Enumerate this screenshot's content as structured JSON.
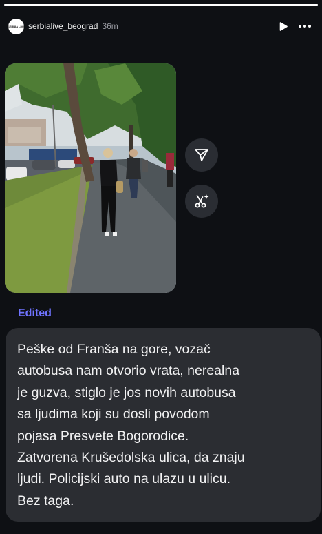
{
  "story": {
    "username": "serbialive_beograd",
    "timestamp": "36m",
    "avatar_text": "SERBIA LIVE",
    "progress": 1.0,
    "icons": {
      "play": "play-icon",
      "more": "more-icon",
      "share": "send-icon",
      "remix": "remix-icon"
    },
    "photo_icon": "street-photo"
  },
  "post": {
    "edited_label": "Edited",
    "caption": "Peške od Franša na gore, vozač\nautobusa nam otvorio vrata, nerealna\nje guzva, stiglo je jos novih autobusa\nsa ljudima koji su dosli povodom\npojasa Presvete Bogorodice.\nZatvorena Krušedolska ulica, da znaju\nljudi. Policijski auto na ulazu u ulicu.\nBez taga."
  },
  "colors": {
    "background": "#0e1014",
    "accent": "#6f73ff",
    "caption_bg": "#2b2d32"
  }
}
